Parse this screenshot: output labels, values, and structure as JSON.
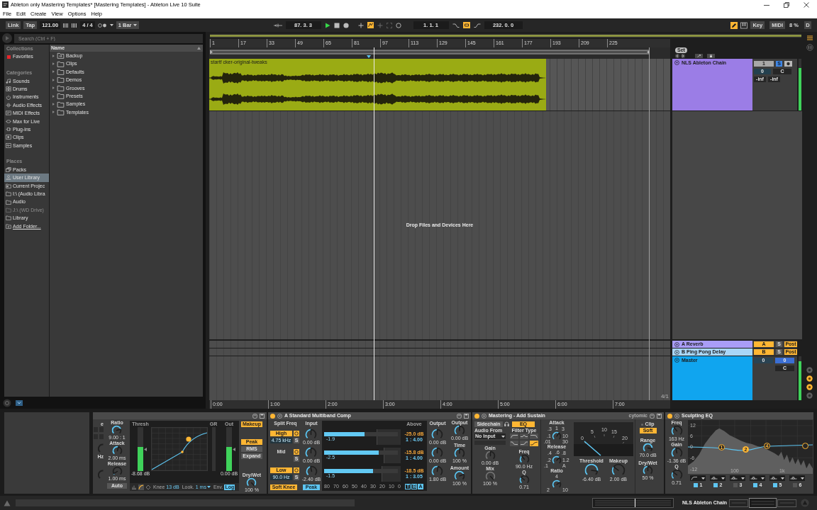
{
  "window": {
    "title": "Ableton only Mastering Templates* [Mastering Templates] - Ableton Live 10 Suite"
  },
  "menu": [
    {
      "label": "File"
    },
    {
      "label": "Edit"
    },
    {
      "label": "Create"
    },
    {
      "label": "View"
    },
    {
      "label": "Options"
    },
    {
      "label": "Help"
    }
  ],
  "control_bar": {
    "link": "Link",
    "tap": "Tap",
    "tempo": "121.00",
    "signature": "4 / 4",
    "quantization": "1 Bar",
    "position": "87. 3. 3",
    "playing": true,
    "automation_arm": true,
    "loop_start": "1. 1. 1",
    "loop": true,
    "loop_length": "232. 0. 0",
    "draw_mode": true,
    "key": "Key",
    "midi": "MIDI",
    "cpu": "8 %",
    "disk": "D"
  },
  "browser": {
    "search": {
      "placeholder": "Search (Ctrl + F)"
    },
    "sections": [
      {
        "title": "Collections",
        "items": [
          {
            "label": "Favorites",
            "kind": "tag",
            "color": "#e8262b",
            "selected": false,
            "disabled": false
          }
        ]
      },
      {
        "title": "Categories",
        "items": [
          {
            "label": "Sounds",
            "kind": "sounds",
            "selected": false,
            "disabled": false
          },
          {
            "label": "Drums",
            "kind": "drums",
            "selected": false,
            "disabled": false
          },
          {
            "label": "Instruments",
            "kind": "instruments",
            "selected": false,
            "disabled": false
          },
          {
            "label": "Audio Effects",
            "kind": "audio-effects",
            "selected": false,
            "disabled": false
          },
          {
            "label": "MIDI Effects",
            "kind": "midi-effects",
            "selected": false,
            "disabled": false
          },
          {
            "label": "Max for Live",
            "kind": "max",
            "selected": false,
            "disabled": false
          },
          {
            "label": "Plug-ins",
            "kind": "plugins",
            "selected": false,
            "disabled": false
          },
          {
            "label": "Clips",
            "kind": "clips",
            "selected": false,
            "disabled": false
          },
          {
            "label": "Samples",
            "kind": "samples",
            "selected": false,
            "disabled": false
          }
        ]
      },
      {
        "title": "Places",
        "items": [
          {
            "label": "Packs",
            "kind": "packs",
            "selected": false,
            "disabled": false
          },
          {
            "label": "User Library",
            "kind": "user",
            "selected": true,
            "disabled": false
          },
          {
            "label": "Current Projec",
            "kind": "project",
            "selected": false,
            "disabled": false
          },
          {
            "label": "I:\\ (Audio Libra",
            "kind": "folder",
            "selected": false,
            "disabled": false
          },
          {
            "label": "Audio",
            "kind": "folder",
            "selected": false,
            "disabled": false
          },
          {
            "label": "J:\\ (WD Drive)",
            "kind": "folder",
            "selected": false,
            "disabled": true
          },
          {
            "label": "Library",
            "kind": "folder",
            "selected": false,
            "disabled": false
          },
          {
            "label": "Add Folder...",
            "kind": "add",
            "selected": false,
            "disabled": false
          }
        ]
      }
    ],
    "name_header": "Name",
    "items": [
      {
        "label": "Backup",
        "kind": "backup",
        "expanded": false
      },
      {
        "label": "Clips",
        "kind": "folder",
        "expanded": false
      },
      {
        "label": "Defaults",
        "kind": "folder",
        "expanded": false
      },
      {
        "label": "Demos",
        "kind": "folder",
        "expanded": false
      },
      {
        "label": "Grooves",
        "kind": "folder",
        "expanded": false
      },
      {
        "label": "Presets",
        "kind": "folder",
        "expanded": false
      },
      {
        "label": "Samples",
        "kind": "folder",
        "expanded": false
      },
      {
        "label": "Templates",
        "kind": "folder",
        "expanded": false
      }
    ]
  },
  "arrangement": {
    "bar_numbers": [
      "1",
      "17",
      "33",
      "49",
      "65",
      "81",
      "97",
      "113",
      "129",
      "145",
      "161",
      "177",
      "193",
      "209",
      "225"
    ],
    "set_label": "Set",
    "tracks": [
      {
        "name": "NLS Ableton Chain",
        "color": "#9b7de6",
        "expanded": true,
        "clips": [
          {
            "name": "startf cker-original-tweaks",
            "color": "#9aab14"
          }
        ],
        "activator": {
          "label": "1",
          "on": true
        },
        "solo": {
          "label": "S",
          "on": true
        },
        "arm": {
          "on": false
        },
        "volume": "0",
        "pan": "C",
        "peaks": [
          "-inf",
          "-inf"
        ],
        "meter": {
          "level": 0.82
        }
      }
    ],
    "drop_hint": "Drop Files and Devices Here",
    "returns": [
      {
        "name": "A Reverb",
        "color": "#a99df7",
        "expanded": false,
        "activator": {
          "label": "A",
          "on": true
        },
        "solo": {
          "label": "S",
          "on": false
        },
        "route": {
          "label": "Post",
          "on": true
        }
      },
      {
        "name": "B Ping Pong Delay",
        "color": "#a9d6f8",
        "expanded": false,
        "activator": {
          "label": "B",
          "on": true
        },
        "solo": {
          "label": "S",
          "on": false
        },
        "route": {
          "label": "Post",
          "on": true
        }
      }
    ],
    "master": {
      "name": "Master",
      "color": "#10a5ef",
      "expanded": true,
      "cue_volume": "0",
      "volume": "0",
      "pan": "C",
      "meter": {
        "level": 0.88
      }
    },
    "zoom_label": "4/1",
    "time_labels": [
      "0:00",
      "1:00",
      "2:00",
      "3:00",
      "4:00",
      "5:00",
      "6:00",
      "7:00"
    ],
    "view_toggles": [
      {
        "on": false
      },
      {
        "on": true
      },
      {
        "on": true
      },
      {
        "on": false
      }
    ]
  },
  "devices": [
    {
      "kind": "compressor",
      "cut_labels": [
        "e",
        "Hz"
      ],
      "knobs": [
        {
          "label": "Ratio",
          "reading": "9.00 : 1",
          "level": 0.78
        },
        {
          "label": "Attack",
          "reading": "2.00 ms",
          "level": 0.55
        },
        {
          "label": "Release",
          "reading": "1.00 ms",
          "level": 0.05
        }
      ],
      "auto": {
        "label": "Auto",
        "on": false
      },
      "display": {
        "thresh_label": "Thresh",
        "gr_label": "GR",
        "out_label": "Out",
        "thresh_value": "-8.68 dB",
        "out_value": "0.00 dB",
        "thresh_meter": {
          "level": 0.55
        },
        "out_meter": {
          "level": 0.55
        }
      },
      "view_modes": [
        {
          "kind": "meters",
          "selected": false
        },
        {
          "kind": "curve",
          "selected": true
        },
        {
          "kind": "activity",
          "selected": false
        }
      ],
      "footer": {
        "knee_label": "Knee",
        "knee": "13 dB",
        "look_label": "Look.",
        "look": "1 ms",
        "env_label": "Env.",
        "env": {
          "label": "Log",
          "on": true
        }
      },
      "buttons": [
        {
          "label": "Makeup",
          "on": true
        },
        {
          "label": "Peak",
          "on": true
        },
        {
          "label": "RMS",
          "on": false
        },
        {
          "label": "Expand",
          "on": false
        }
      ],
      "drywet": {
        "label": "Dry/Wet",
        "reading": "100 %",
        "level": 1
      }
    },
    {
      "kind": "multiband",
      "on": true,
      "expanded": true,
      "title": "A Standard Multiband Comp",
      "split_label": "Split Freq",
      "input_label": "Input",
      "above_label": "Above",
      "output_label": "Output",
      "bands": [
        {
          "kind": "edge",
          "name": "High",
          "name_on": true,
          "power_on": true,
          "freq": "4.75 kHz",
          "solo": "S",
          "solo_on": false,
          "input": {
            "reading": "0.00 dB",
            "level": 0.5
          },
          "meter": {
            "level": 0.55
          },
          "meter_reading": "-1.9",
          "threshold": "-25.0 dB",
          "ratio": "1 : 4.00",
          "output": {
            "reading": "0.00 dB",
            "level": 0.5
          }
        },
        {
          "kind": "mid",
          "name": "Mid",
          "power_on": true,
          "solo": "S",
          "solo_on": false,
          "input": {
            "reading": "0.00 dB",
            "level": 0.5
          },
          "meter": {
            "level": 0.74
          },
          "meter_reading": "-2.5",
          "threshold": "-15.8 dB",
          "ratio": "1 : 4.00",
          "output": {
            "reading": "0.00 dB",
            "level": 0.5
          }
        },
        {
          "kind": "edge",
          "name": "Low",
          "name_on": true,
          "power_on": true,
          "freq": "90.0 Hz",
          "solo": "S",
          "solo_on": false,
          "input": {
            "reading": "-2.40 dB",
            "level": 0.45
          },
          "meter": {
            "level": 0.66
          },
          "meter_reading": "-1.5",
          "threshold": "-18.5 dB",
          "ratio": "1 : 3.05",
          "output": {
            "reading": "1.80 dB",
            "level": 0.53
          }
        }
      ],
      "soft_knee": {
        "label": "Soft Knee",
        "on": true
      },
      "peak": {
        "label": "Peak",
        "on": true
      },
      "scale": [
        "80",
        "70",
        "60",
        "50",
        "40",
        "30",
        "20",
        "10",
        "0"
      ],
      "mode_buttons": [
        {
          "label": "T",
          "on": false
        },
        {
          "label": "B",
          "on": false
        },
        {
          "label": "A",
          "on": true
        }
      ],
      "global": [
        {
          "label": "Output",
          "reading": "0.00 dB",
          "level": 0.5
        },
        {
          "label": "Time",
          "reading": "100 %",
          "level": 0.5
        },
        {
          "label": "Amount",
          "reading": "100 %",
          "level": 0.75
        }
      ]
    },
    {
      "kind": "glue",
      "on": true,
      "expanded": false,
      "title": "Mastering - Add Sustain",
      "brand": "cytomic",
      "sidechain": {
        "label": "Sidechain",
        "on": false
      },
      "eq": {
        "label": "EQ",
        "on": true
      },
      "audio_from_label": "Audio From",
      "audio_from": "No Input",
      "gain": {
        "label": "Gain",
        "reading": "0.00 dB",
        "level": 0.5
      },
      "mix": {
        "label": "Mix",
        "reading": "100 %",
        "level": 1
      },
      "filter_label": "Filter Type",
      "filter_types": [
        {
          "kind": "lowcut",
          "selected": false
        },
        {
          "kind": "bandpass",
          "selected": false
        },
        {
          "kind": "highcut",
          "selected": false
        },
        {
          "kind": "lowshelf",
          "selected": false
        },
        {
          "kind": "highshelf",
          "selected": false
        },
        {
          "kind": "shelfcut",
          "selected": true
        }
      ],
      "freq": {
        "label": "Freq",
        "reading": "90.0 Hz",
        "level": 0.35
      },
      "q": {
        "label": "Q",
        "reading": "0.71",
        "level": 0.3
      },
      "attack": {
        "label": "Attack",
        "scale": [
          ".3",
          "1",
          "3",
          ".1",
          "10",
          ".01",
          "30"
        ],
        "level": 0.62
      },
      "release": {
        "label": "Release",
        "scale": [
          ".4",
          ".6",
          ".8",
          ".2",
          "1.2",
          ".1",
          "A"
        ],
        "level": 0.66
      },
      "ratio": {
        "label": "Ratio",
        "scale": [
          "4",
          "2",
          "10"
        ],
        "level": 0.7
      },
      "meter_scale": [
        "0",
        "5",
        "10",
        "15",
        "20"
      ],
      "threshold": {
        "label": "Threshold",
        "reading": "-6.40 dB",
        "level": 0.86
      },
      "makeup": {
        "label": "Makeup",
        "reading": "2.00 dB",
        "level": 0.3
      },
      "clip": {
        "label": "Clip",
        "mode": "Soft",
        "on": true
      },
      "range": {
        "label": "Range",
        "reading": "70.0 dB",
        "level": 0.85
      },
      "drywet": {
        "label": "Dry/Wet",
        "reading": "50 %",
        "level": 0.5
      }
    },
    {
      "kind": "eq8",
      "on": true,
      "expanded": false,
      "title": "Sculpting EQ",
      "knobs": [
        {
          "label": "Freq",
          "reading": "163 Hz",
          "level": 0.35
        },
        {
          "label": "Gain",
          "reading": "-1.36 dB",
          "level": 0.45
        },
        {
          "label": "Q",
          "reading": "0.71",
          "level": 0.3
        }
      ],
      "gain_ticks": [
        "12",
        "6",
        "0",
        "-6",
        "-12"
      ],
      "freq_ticks": [
        "100",
        "1k"
      ],
      "points": [
        {
          "label": "1",
          "selected": false
        },
        {
          "label": "2",
          "selected": true
        },
        {
          "label": "4",
          "selected": false
        },
        {
          "selected": false
        }
      ],
      "bands": [
        {
          "label": "1",
          "kind": "lowcut",
          "on": true
        },
        {
          "label": "2",
          "kind": "bell",
          "on": true
        },
        {
          "label": "3",
          "kind": "bell",
          "on": false
        },
        {
          "label": "4",
          "kind": "bell",
          "on": true
        },
        {
          "label": "5",
          "kind": "bell",
          "on": true
        },
        {
          "label": "6",
          "kind": "bell",
          "on": false
        }
      ]
    }
  ],
  "status_bar": {
    "chain_name": "NLS Ableton Chain"
  }
}
